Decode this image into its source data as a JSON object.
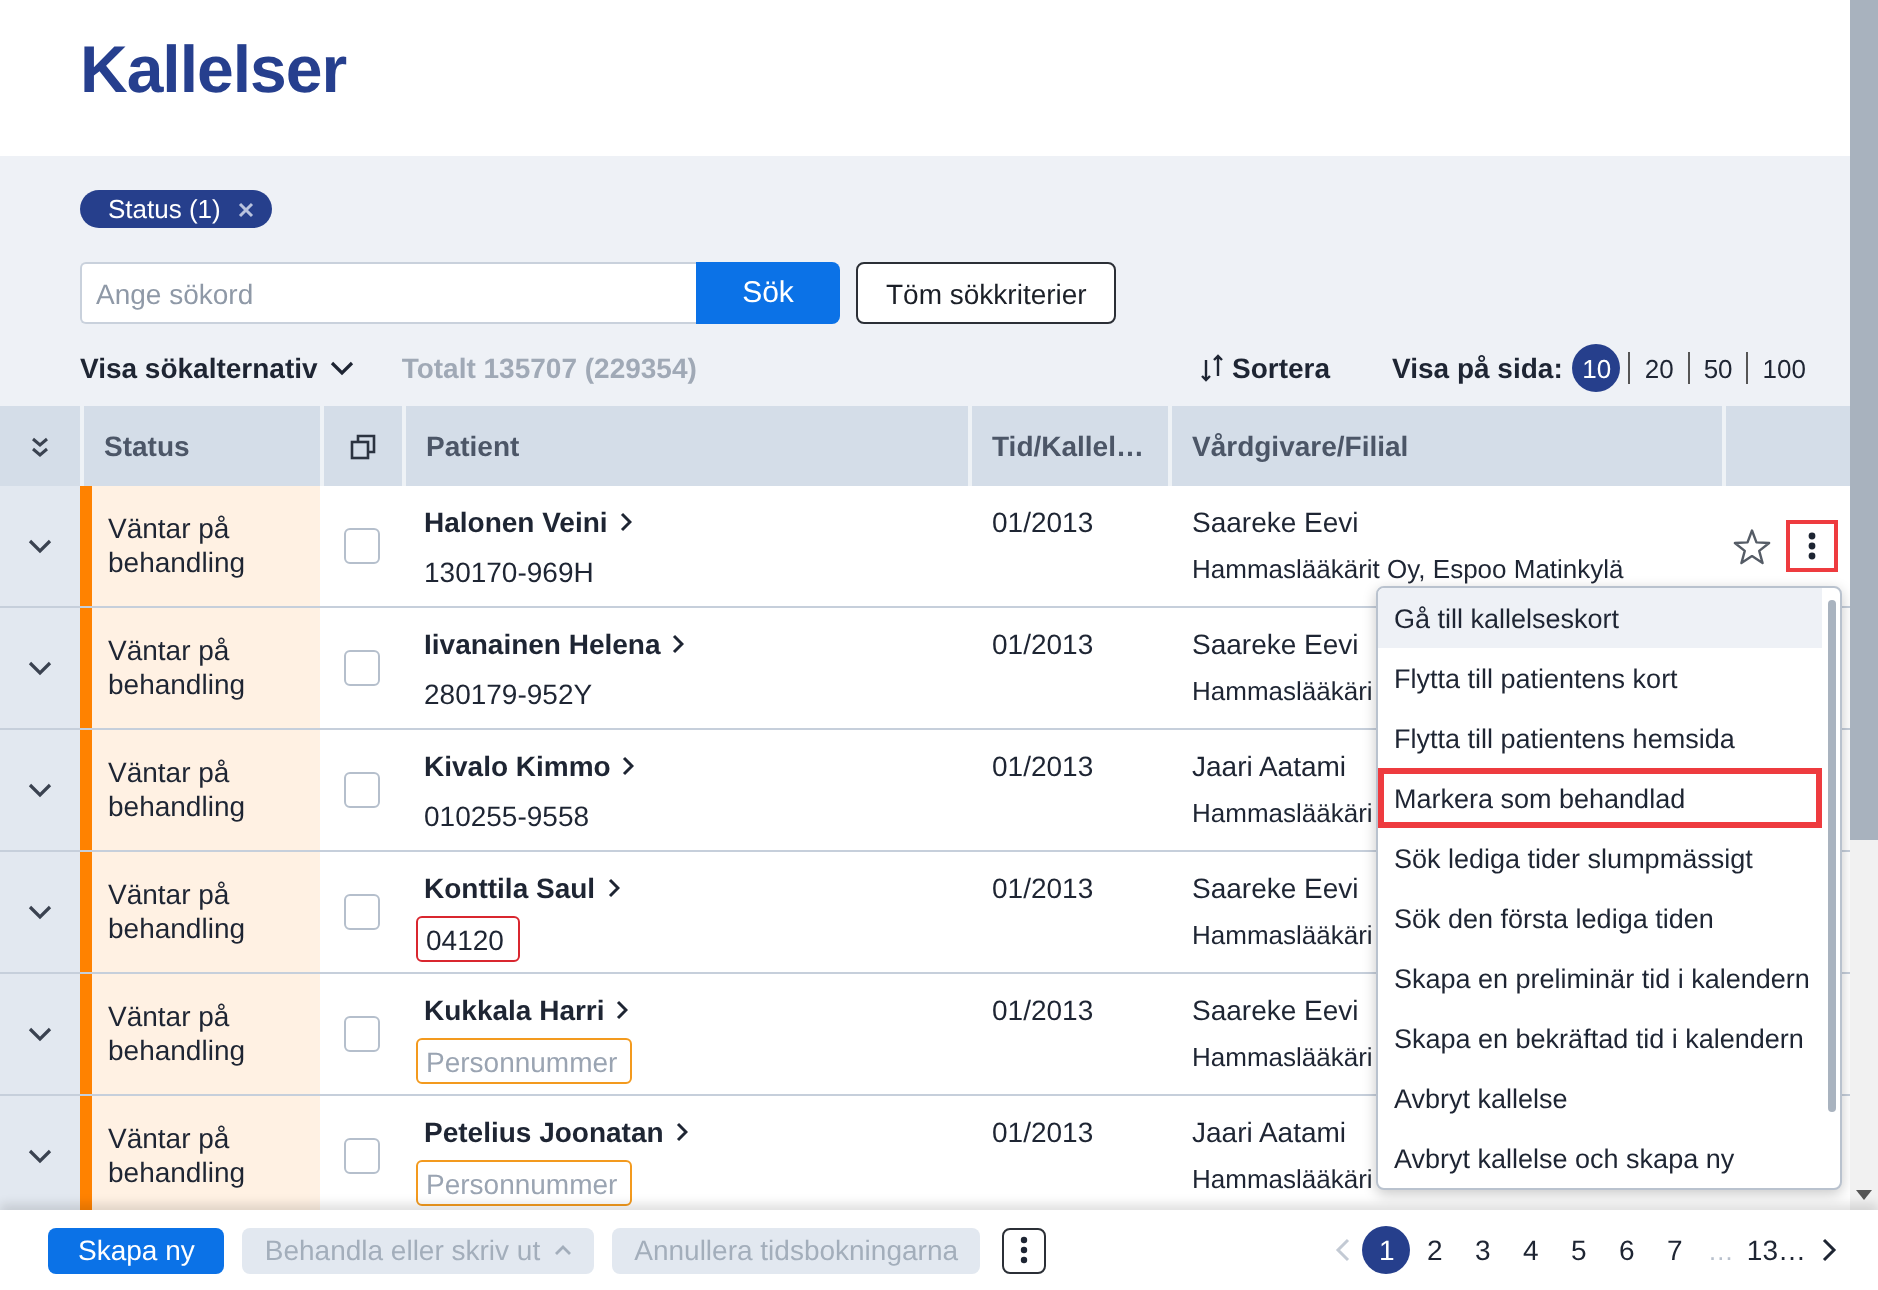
{
  "page": {
    "title": "Kallelser"
  },
  "filters": {
    "chips": [
      {
        "label": "Status (1)"
      }
    ],
    "search": {
      "placeholder": "Ange sökord",
      "button": "Sök"
    },
    "clear_button": "Töm sökkriterier",
    "options_toggle": {
      "label": "Visa sökalternativ",
      "expanded": false
    },
    "total": "Totalt 135707 (229354)",
    "sort_button": "Sortera",
    "page_size": {
      "label": "Visa på sida:",
      "options": [
        {
          "label": "10",
          "selected": true
        },
        {
          "label": "20",
          "selected": false
        },
        {
          "label": "50",
          "selected": false
        },
        {
          "label": "100",
          "selected": false
        }
      ]
    }
  },
  "table": {
    "columns": [
      {
        "kind": "expand_all"
      },
      {
        "kind": "text",
        "label": "Status"
      },
      {
        "kind": "select_all"
      },
      {
        "kind": "text",
        "label": "Patient"
      },
      {
        "kind": "text",
        "label": "Tid/Kallel…"
      },
      {
        "kind": "text",
        "label": "Vårdgivare/Filial"
      },
      {
        "kind": "actions"
      }
    ],
    "rows": [
      {
        "expanded": false,
        "status": {
          "label": "Väntar på behandling",
          "color": "#ff8200"
        },
        "checked": false,
        "patient": {
          "name": "Halonen Veini",
          "id": {
            "kind": "text",
            "value": "130170-969H"
          }
        },
        "time": "01/2013",
        "provider": {
          "name": "Saareke Eevi",
          "clinic": "Hammaslääkärit Oy, Espoo Matinkylä"
        },
        "starred": false,
        "menu_button": {
          "highlighted": true
        }
      },
      {
        "expanded": false,
        "status": {
          "label": "Väntar på behandling",
          "color": "#ff8200"
        },
        "checked": false,
        "patient": {
          "name": "Iivanainen Helena",
          "id": {
            "kind": "text",
            "value": "280179-952Y"
          }
        },
        "time": "01/2013",
        "provider": {
          "name": "Saareke Eevi",
          "clinic": "Hammaslääkäri"
        }
      },
      {
        "expanded": false,
        "status": {
          "label": "Väntar på behandling",
          "color": "#ff8200"
        },
        "checked": false,
        "patient": {
          "name": "Kivalo Kimmo",
          "id": {
            "kind": "text",
            "value": "010255-9558"
          }
        },
        "time": "01/2013",
        "provider": {
          "name": "Jaari Aatami",
          "clinic": "Hammaslääkäri"
        }
      },
      {
        "expanded": false,
        "status": {
          "label": "Väntar på behandling",
          "color": "#ff8200"
        },
        "checked": false,
        "patient": {
          "name": "Konttila Saul",
          "id": {
            "kind": "field",
            "value": "04120",
            "error": true,
            "warning": false
          }
        },
        "time": "01/2013",
        "provider": {
          "name": "Saareke Eevi",
          "clinic": "Hammaslääkäri"
        }
      },
      {
        "expanded": false,
        "status": {
          "label": "Väntar på behandling",
          "color": "#ff8200"
        },
        "checked": false,
        "patient": {
          "name": "Kukkala Harri",
          "id": {
            "kind": "field",
            "placeholder": "Personnummer",
            "error": false,
            "warning": true
          }
        },
        "time": "01/2013",
        "provider": {
          "name": "Saareke Eevi",
          "clinic": "Hammaslääkäri"
        }
      },
      {
        "expanded": false,
        "status": {
          "label": "Väntar på behandling",
          "color": "#ff8200"
        },
        "checked": false,
        "patient": {
          "name": "Petelius Joonatan",
          "id": {
            "kind": "field",
            "placeholder": "Personnummer",
            "error": false,
            "warning": true
          }
        },
        "time": "01/2013",
        "provider": {
          "name": "Jaari Aatami",
          "clinic": "Hammaslääkäri"
        }
      }
    ]
  },
  "context_menu": {
    "items": [
      {
        "label": "Gå till kallelseskort",
        "hovered": true,
        "highlighted": false
      },
      {
        "label": "Flytta till patientens kort",
        "hovered": false,
        "highlighted": false
      },
      {
        "label": "Flytta till patientens hemsida",
        "hovered": false,
        "highlighted": false
      },
      {
        "label": "Markera som behandlad",
        "hovered": false,
        "highlighted": true
      },
      {
        "label": "Sök lediga tider slumpmässigt",
        "hovered": false,
        "highlighted": false
      },
      {
        "label": "Sök den första lediga tiden",
        "hovered": false,
        "highlighted": false
      },
      {
        "label": "Skapa en preliminär tid i kalendern",
        "hovered": false,
        "highlighted": false
      },
      {
        "label": "Skapa en bekräftad tid i kalendern",
        "hovered": false,
        "highlighted": false
      },
      {
        "label": "Avbryt kallelse",
        "hovered": false,
        "highlighted": false
      },
      {
        "label": "Avbryt kallelse och skapa ny",
        "hovered": false,
        "highlighted": false
      }
    ]
  },
  "footer": {
    "buttons": [
      {
        "kind": "primary",
        "label": "Skapa ny",
        "disabled": false
      },
      {
        "kind": "dropdown",
        "label": "Behandla eller skriv ut",
        "disabled": true
      },
      {
        "kind": "secondary",
        "label": "Annullera tidsbokningarna",
        "disabled": true
      },
      {
        "kind": "more",
        "disabled": false
      }
    ],
    "pagination": {
      "prev_disabled": true,
      "next_disabled": false,
      "items": [
        {
          "kind": "page",
          "label": "1",
          "selected": true
        },
        {
          "kind": "page",
          "label": "2",
          "selected": false
        },
        {
          "kind": "page",
          "label": "3",
          "selected": false
        },
        {
          "kind": "page",
          "label": "4",
          "selected": false
        },
        {
          "kind": "page",
          "label": "5",
          "selected": false
        },
        {
          "kind": "page",
          "label": "6",
          "selected": false
        },
        {
          "kind": "page",
          "label": "7",
          "selected": false
        },
        {
          "kind": "gap",
          "label": "…"
        },
        {
          "kind": "page",
          "label": "13…",
          "selected": false
        }
      ]
    }
  }
}
